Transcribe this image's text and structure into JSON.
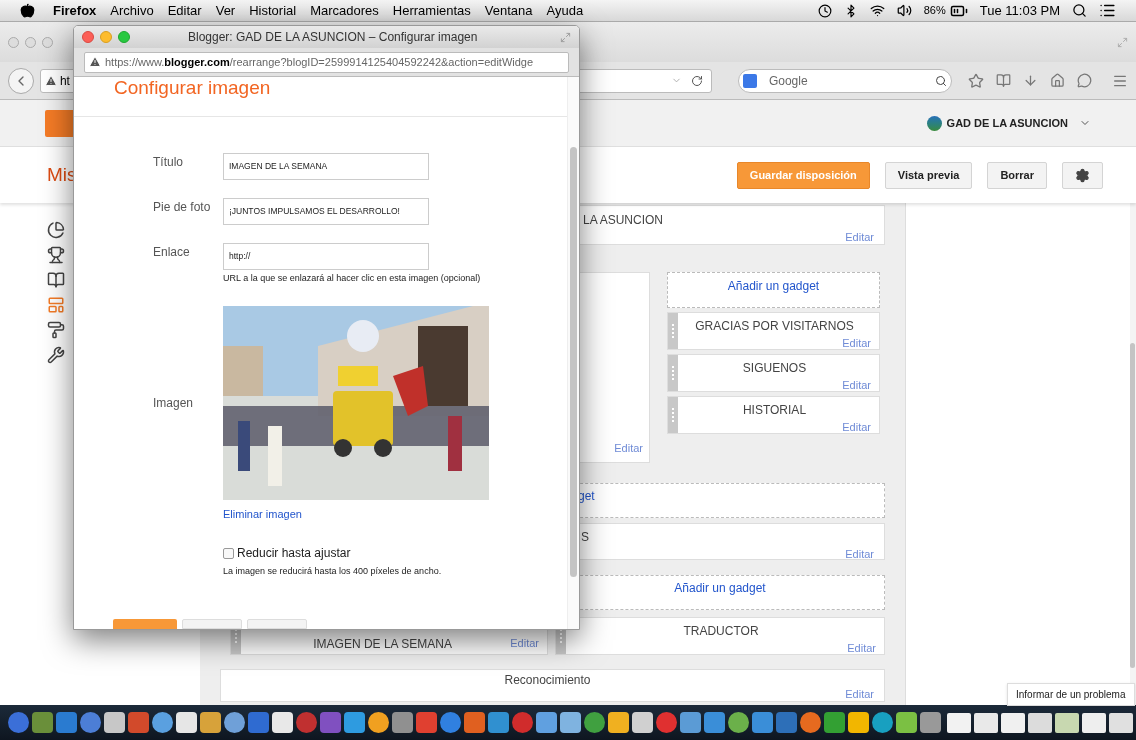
{
  "menu_bar": {
    "app": "Firefox",
    "menus": [
      "Archivo",
      "Editar",
      "Ver",
      "Historial",
      "Marcadores",
      "Herramientas",
      "Ventana",
      "Ayuda"
    ],
    "battery": "86%",
    "clock": "Tue 11:03 PM"
  },
  "browser": {
    "url_visible": "ht",
    "search_placeholder": "Google"
  },
  "blogger": {
    "blog_name": "GAD DE LA ASUNCION",
    "page_title": "Mis",
    "buttons": [
      {
        "label": "Guardar disposición",
        "kind": "primary"
      },
      {
        "label": "Vista previa",
        "kind": "default"
      },
      {
        "label": "Borrar",
        "kind": "default"
      }
    ],
    "sidebar": [
      {
        "selected": false
      },
      {
        "selected": false
      },
      {
        "selected": false
      },
      {
        "selected": true
      },
      {
        "selected": false
      },
      {
        "selected": false
      }
    ]
  },
  "layout": {
    "header_gadget": {
      "title": "LA ASUNCION",
      "edit": "Editar"
    },
    "left_gadget": {
      "edit": "Editar"
    },
    "side_add": "Añadir un gadget",
    "side_gadgets": [
      {
        "title": "GRACIAS POR VISITARNOS",
        "edit": "Editar"
      },
      {
        "title": "SIGUENOS",
        "edit": "Editar"
      },
      {
        "title": "HISTORIAL",
        "edit": "Editar"
      }
    ],
    "main_rows": [
      {
        "kind": "add",
        "text": "get"
      },
      {
        "kind": "gadget",
        "title": "S",
        "edit": "Editar"
      },
      {
        "kind": "add",
        "text": "Añadir un gadget"
      }
    ],
    "bottom_gadgets": [
      {
        "title": "IMAGEN DE LA SEMANA",
        "edit": "Editar"
      },
      {
        "title": "TRADUCTOR",
        "edit": "Editar"
      }
    ],
    "footer_gadget": {
      "title": "Reconocimiento",
      "edit": "Editar"
    }
  },
  "report_button": "Informar de un problema",
  "popup": {
    "window_title": "Blogger: GAD DE LA ASUNCION – Configurar imagen",
    "url": "https://www.**blogger.com**/rearrange?blogID=2599914125404592242&action=editWidge",
    "heading": "Configurar imagen",
    "fields": [
      {
        "label": "Título",
        "value": "IMAGEN DE LA SEMANA"
      },
      {
        "label": "Pie de foto",
        "value": "¡JUNTOS IMPULSAMOS EL DESARROLLO!"
      },
      {
        "label": "Enlace",
        "value": "http://",
        "hint": "URL a la que se enlazará al hacer clic en esta imagen (opcional)"
      }
    ],
    "image": {
      "label": "Imagen",
      "remove_link": "Eliminar imagen"
    },
    "shrink": {
      "label": "Reducir hasta ajustar",
      "checked": false,
      "hint": "La imagen se reducirá hasta los 400 píxeles de ancho."
    }
  }
}
